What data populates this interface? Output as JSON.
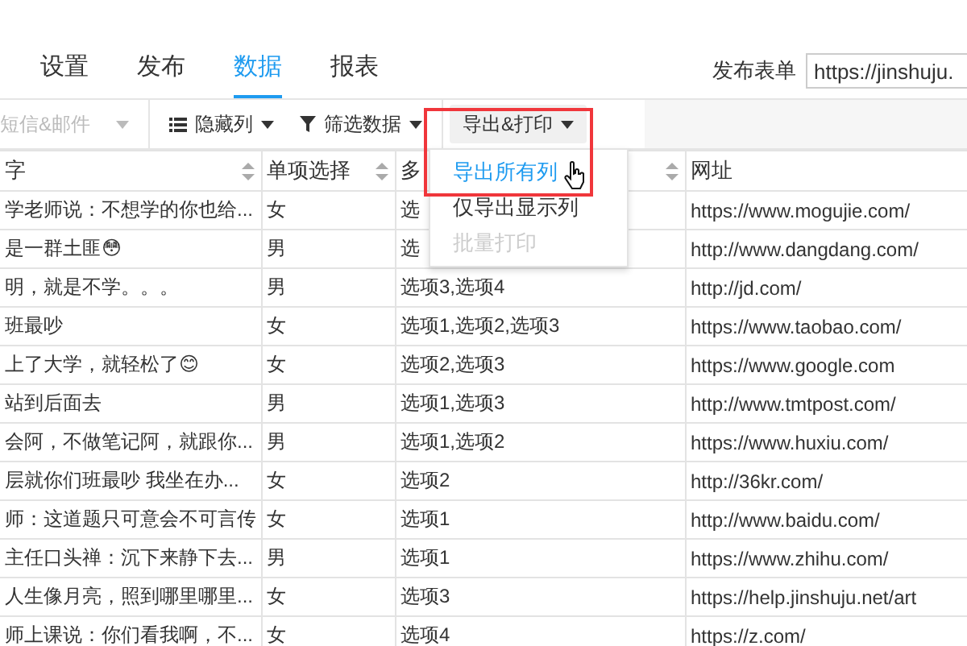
{
  "tabs": [
    {
      "label": "设置",
      "selected": false
    },
    {
      "label": "发布",
      "selected": false
    },
    {
      "label": "数据",
      "selected": true
    },
    {
      "label": "报表",
      "selected": false
    }
  ],
  "publish": {
    "label": "发布表单",
    "value": "https://jinshuju."
  },
  "toolbar": [
    {
      "kind": "dropdown",
      "label": "短信&邮件",
      "disabled": true
    },
    {
      "kind": "columns",
      "label": "隐藏列",
      "disabled": false
    },
    {
      "kind": "filter",
      "label": "筛选数据",
      "disabled": false
    },
    {
      "kind": "export",
      "label": "导出&打印",
      "disabled": false,
      "open": true
    }
  ],
  "menu": [
    {
      "label": "导出所有列",
      "highlighted": true,
      "disabled": false
    },
    {
      "label": "仅导出显示列",
      "highlighted": false,
      "disabled": false
    },
    {
      "label": "批量打印",
      "highlighted": false,
      "disabled": true
    }
  ],
  "table": {
    "columns": [
      {
        "label": "字",
        "sortable": true
      },
      {
        "label": "单项选择",
        "sortable": true
      },
      {
        "label": "多",
        "sortable": true
      },
      {
        "label": "网址",
        "sortable": false
      }
    ],
    "rows": [
      [
        "学老师说：不想学的你也给...",
        "女",
        "选",
        "https://www.mogujie.com/"
      ],
      [
        "是一群土匪😳",
        "男",
        "选",
        "http://www.dangdang.com/"
      ],
      [
        "明，就是不学。。。",
        "男",
        "选项3,选项4",
        "http://jd.com/"
      ],
      [
        "班最吵",
        "女",
        "选项1,选项2,选项3",
        "https://www.taobao.com/"
      ],
      [
        "上了大学，就轻松了😊",
        "女",
        "选项2,选项3",
        "https://www.google.com"
      ],
      [
        "站到后面去",
        "男",
        "选项1,选项3",
        "http://www.tmtpost.com/"
      ],
      [
        "会阿，不做笔记阿，就跟你...",
        "男",
        "选项1,选项2",
        "https://www.huxiu.com/"
      ],
      [
        "层就你们班最吵 我坐在办...",
        "女",
        "选项2",
        "http://36kr.com/"
      ],
      [
        "师：这道题只可意会不可言传",
        "女",
        "选项1",
        "http://www.baidu.com/"
      ],
      [
        "主任口头禅：沉下来静下去...",
        "男",
        "选项1",
        "https://www.zhihu.com/"
      ],
      [
        "人生像月亮，照到哪里哪里...",
        "女",
        "选项3",
        "https://help.jinshuju.net/art"
      ],
      [
        "师上课说：你们看我啊，不...",
        "女",
        "选项4",
        "https://z.com/"
      ]
    ]
  }
}
